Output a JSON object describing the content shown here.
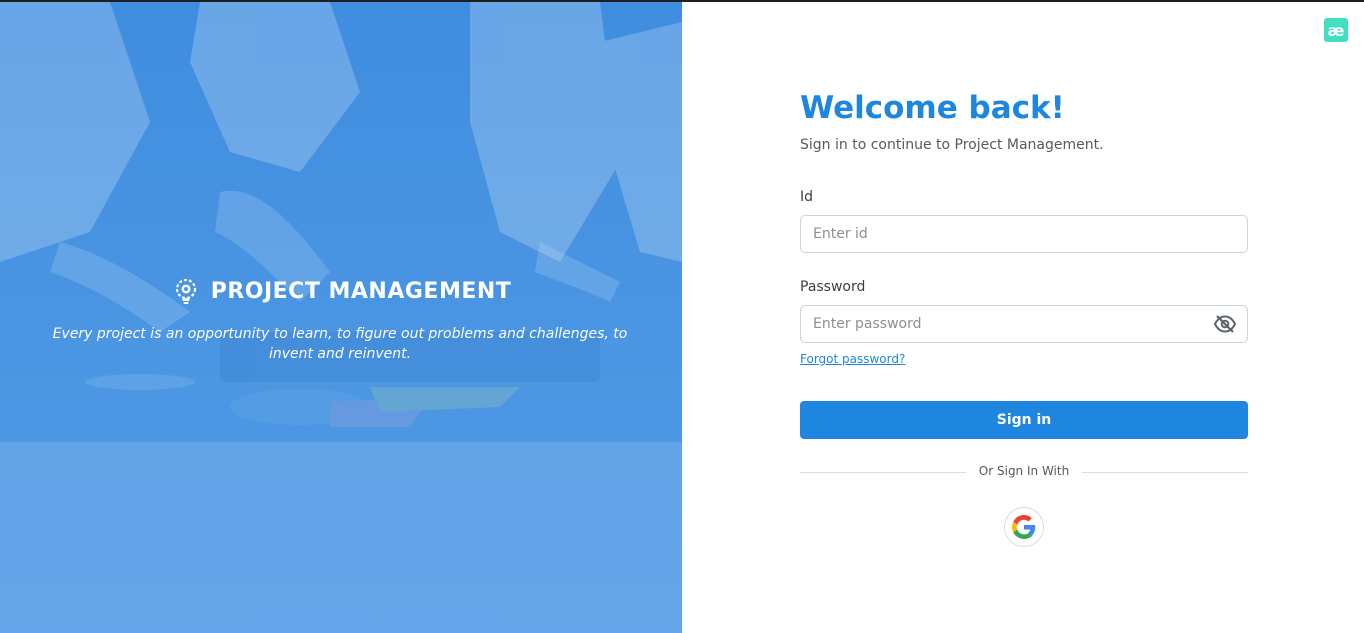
{
  "hero": {
    "brand_title": "PROJECT MANAGEMENT",
    "tagline": "Every project is an opportunity to learn, to figure out problems and challenges, to invent and reinvent.",
    "overlay_color": "#3f8de0"
  },
  "panel": {
    "corner_logo": "æ",
    "welcome": "Welcome back!",
    "subtitle": "Sign in to continue to Project Management.",
    "id_label": "Id",
    "id_placeholder": "Enter id",
    "password_label": "Password",
    "password_placeholder": "Enter password",
    "forgot_label": "Forgot password?",
    "signin_label": "Sign in",
    "divider_text": "Or Sign In With",
    "accent_color": "#1f86e0"
  },
  "icons": {
    "brand": "bulb-gear-icon",
    "eye": "eye-off-icon",
    "google": "google-icon"
  }
}
